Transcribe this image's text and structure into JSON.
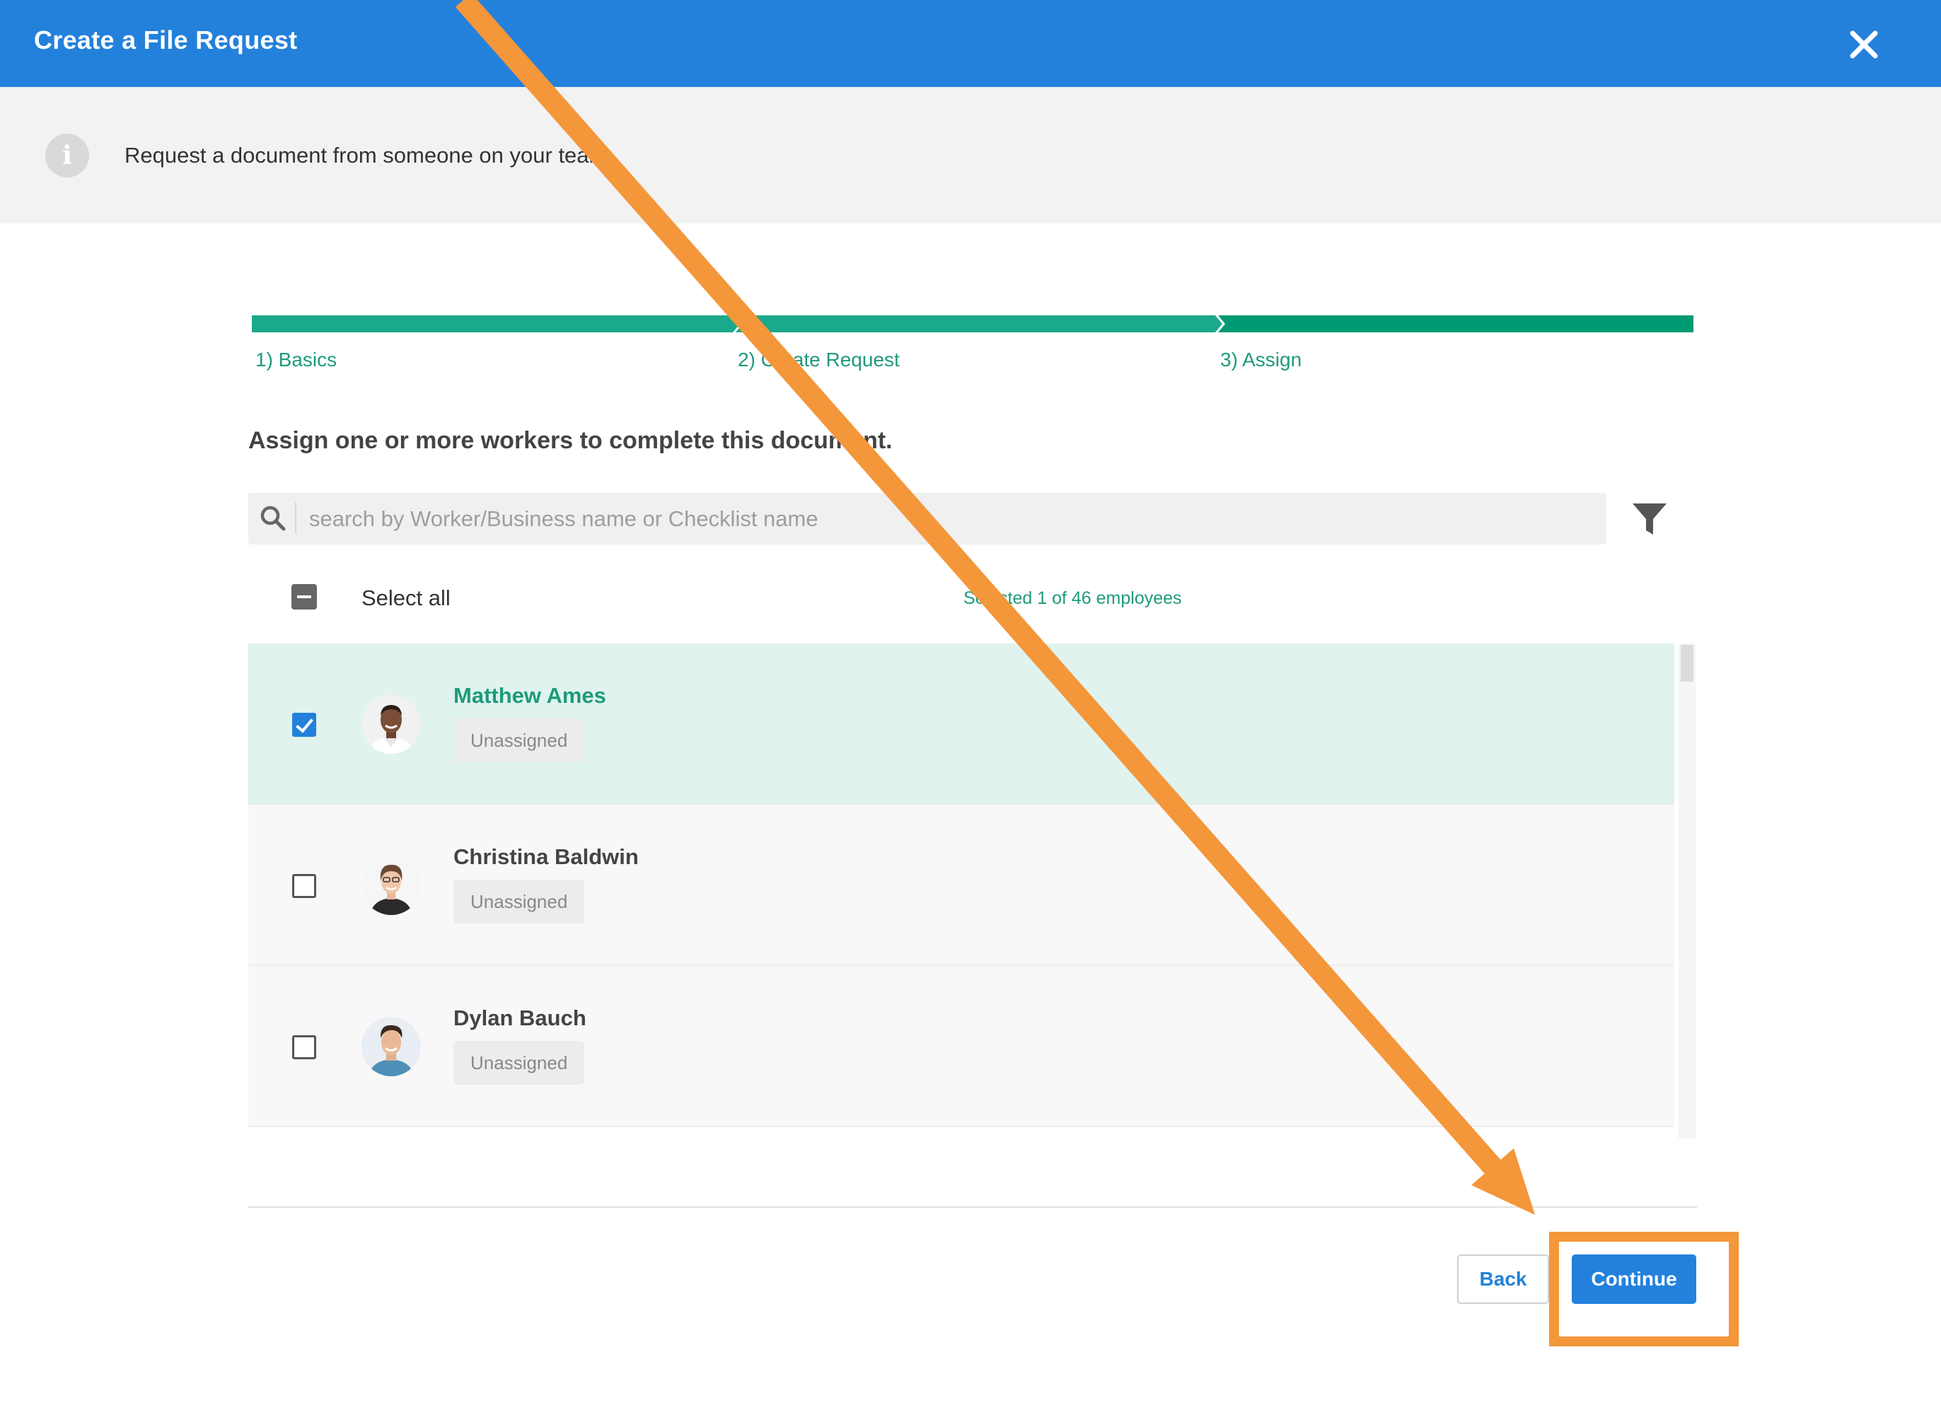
{
  "dialog": {
    "title": "Create a File Request",
    "close_icon": "close-icon"
  },
  "info": {
    "icon": "info-icon",
    "glyph": "i",
    "text": "Request a document from someone on your team."
  },
  "stepper": {
    "steps": [
      {
        "label": "1) Basics",
        "state": "complete"
      },
      {
        "label": "2) Create Request",
        "state": "complete"
      },
      {
        "label": "3) Assign",
        "state": "active"
      }
    ],
    "complete_color": "#1aa98a",
    "active_color": "#009a72"
  },
  "assign": {
    "heading": "Assign one or more workers to complete this document."
  },
  "search": {
    "icon": "search-icon",
    "value": "",
    "placeholder": "search by Worker/Business name or Checklist name",
    "filter_icon": "filter-icon"
  },
  "selection": {
    "select_all_label": "Select all",
    "select_all_state": "indeterminate",
    "count_text": "Selected 1 of 46 employees"
  },
  "workers": [
    {
      "name": "Matthew Ames",
      "status": "Unassigned",
      "checked": true
    },
    {
      "name": "Christina Baldwin",
      "status": "Unassigned",
      "checked": false
    },
    {
      "name": "Dylan Bauch",
      "status": "Unassigned",
      "checked": false
    }
  ],
  "footer": {
    "back_label": "Back",
    "continue_label": "Continue"
  },
  "colors": {
    "header": "#2381db",
    "primary": "#2381db",
    "teal_text": "#1e9a7c",
    "selected_row": "#e0f3ee",
    "annotation": "#f4963a"
  },
  "annotation": {
    "highlight": "continue-button",
    "style": "arrow-and-box"
  }
}
